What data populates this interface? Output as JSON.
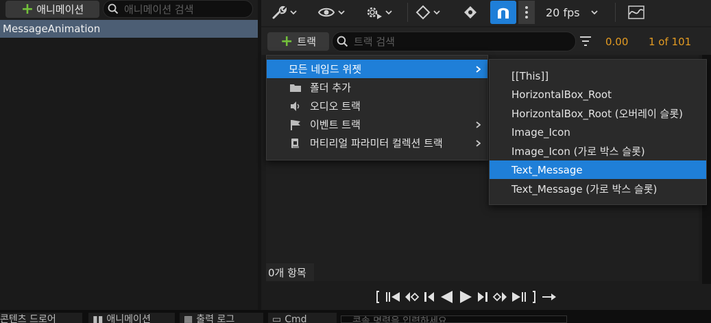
{
  "animations_panel": {
    "add_button_label": "애니메이션",
    "search_placeholder": "애니메이션 검색",
    "items": [
      "MessageAnimation"
    ]
  },
  "toolbar": {
    "icons": [
      "wrench-icon",
      "eye-icon",
      "gear-play-icon",
      "keyframe-icon",
      "key-icon",
      "snap-magnet-icon",
      "more-icon",
      "curve-editor-icon"
    ],
    "fps_label": "20 fps",
    "accent_color": "#1f7fd8"
  },
  "sequencer": {
    "add_track_label": "트랙",
    "track_search_placeholder": "트랙 검색",
    "current_time": "0.00",
    "frame_counter": "1 of 101",
    "item_count": "0개 항목",
    "time_color": "#e39b22"
  },
  "context_menu": {
    "items": [
      {
        "label": "모든 네임드 위젯",
        "icon": "none",
        "submenu": true,
        "selected": true
      },
      {
        "label": "폴더 추가",
        "icon": "folder-icon",
        "submenu": false
      },
      {
        "label": "오디오 트랙",
        "icon": "speaker-icon",
        "submenu": false
      },
      {
        "label": "이벤트 트랙",
        "icon": "flag-icon",
        "submenu": true
      },
      {
        "label": "머티리얼 파라미터 컬렉션 트랙",
        "icon": "material-collection-icon",
        "submenu": true
      }
    ]
  },
  "submenu": {
    "items": [
      {
        "label": "[[This]]"
      },
      {
        "label": "HorizontalBox_Root"
      },
      {
        "label": "HorizontalBox_Root (오버레이 슬롯)"
      },
      {
        "label": "Image_Icon"
      },
      {
        "label": "Image_Icon (가로 박스 슬롯)"
      },
      {
        "label": "Text_Message",
        "selected": true
      },
      {
        "label": "Text_Message (가로 박스 슬롯)"
      }
    ]
  },
  "bottom_tabs": {
    "tabs": [
      "콘텐츠 드로어",
      "애니메이션",
      "출력 로그",
      "Cmd"
    ],
    "console_placeholder": "콘솔 명령을 입력하세요"
  }
}
